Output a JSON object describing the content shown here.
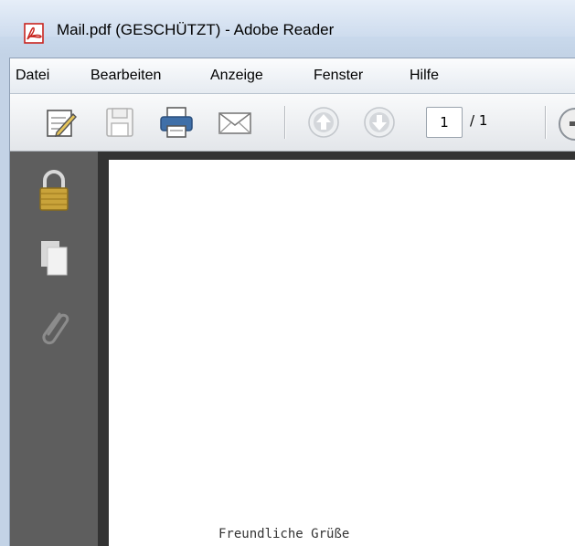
{
  "window": {
    "title": "Mail.pdf (GESCHÜTZT) - Adobe Reader"
  },
  "menu": {
    "items": [
      "Datei",
      "Bearbeiten",
      "Anzeige",
      "Fenster",
      "Hilfe"
    ]
  },
  "toolbar": {
    "current_page": "1",
    "page_total": "/ 1"
  },
  "document": {
    "visible_text": "Freundliche Grüße"
  },
  "colors": {
    "pdf_icon_red": "#c8251f",
    "sidenav_bg": "#5e5e5e",
    "lock_gold": "#c9a33a"
  }
}
